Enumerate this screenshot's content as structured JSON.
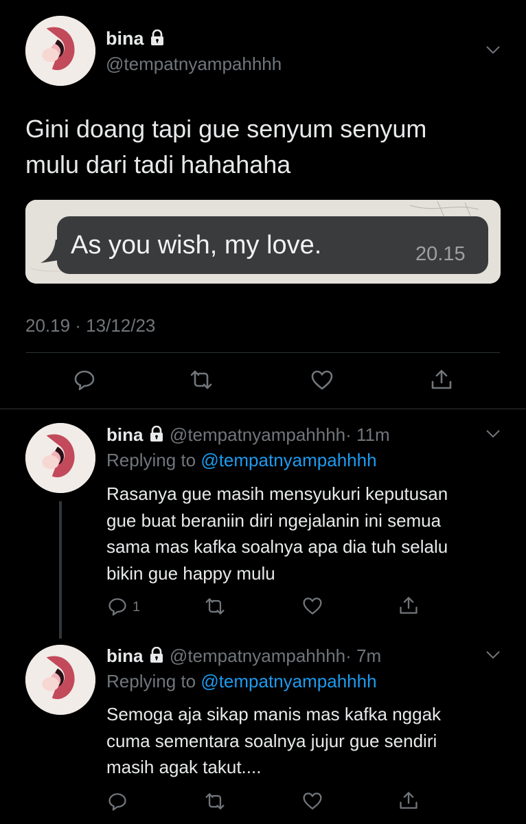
{
  "main_tweet": {
    "display_name": "bina",
    "handle": "@tempatnyampahhhh",
    "text_line1": "Gini doang tapi gue senyum senyum",
    "text_line2": "mulu dari tadi hahahaha",
    "media": {
      "bubble_text": "As you wish, my love.",
      "bubble_time": "20.15"
    },
    "timestamp": "20.19 · 13/12/23"
  },
  "replies": [
    {
      "display_name": "bina",
      "handle": "@tempatnyampahhhh",
      "time": "· 11m",
      "replying_prefix": "Replying to",
      "replying_handle": "@tempatnyampahhhh",
      "lines": [
        "Rasanya gue masih mensyukuri keputusan",
        "gue buat beraniin diri ngejalanin ini semua",
        "sama mas kafka soalnya apa dia tuh selalu",
        "bikin gue happy mulu"
      ],
      "reply_count": "1"
    },
    {
      "display_name": "bina",
      "handle": "@tempatnyampahhhh",
      "time": "· 7m",
      "replying_prefix": "Replying to",
      "replying_handle": "@tempatnyampahhhh",
      "lines": [
        "Semoga aja sikap manis mas kafka nggak",
        "cuma sementara soalnya jujur gue sendiri",
        "masih agak takut...."
      ]
    }
  ],
  "colors": {
    "background": "#000000",
    "text": "#e7e9ea",
    "muted": "#71767b",
    "link": "#1d9bf0",
    "divider": "#2f3336"
  },
  "icons": [
    "lock-icon",
    "chevron-down-icon",
    "reply-icon",
    "retweet-icon",
    "like-icon",
    "share-icon"
  ]
}
